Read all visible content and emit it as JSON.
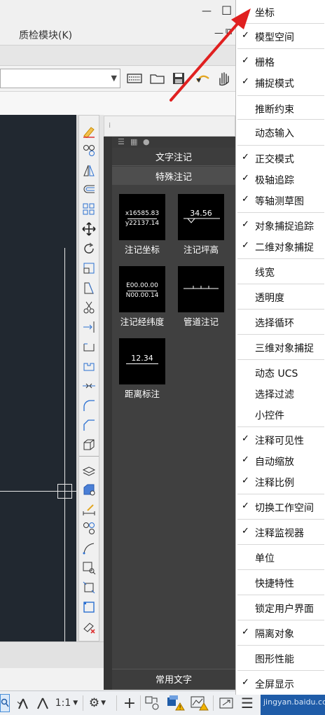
{
  "window": {
    "minimize": "—",
    "maximize": "☐",
    "minimize2": "—",
    "restore2": "⧉"
  },
  "menu_bar": {
    "qc_module": "质检模块(K)"
  },
  "palette": {
    "tab_text": "文字注记",
    "tab_special": "特殊注记",
    "tab_common": "常用文字",
    "tools": [
      {
        "label": "注记坐标",
        "line1": "x16585.83",
        "line2": "y22137.14"
      },
      {
        "label": "注记坪高",
        "line1": "34.56"
      },
      {
        "label": "注记经纬度",
        "line1": "E00.00.00",
        "line2": "N00.00.14"
      },
      {
        "label": "管道注记"
      },
      {
        "label": "距离标注",
        "line1": "12.34"
      }
    ]
  },
  "statusbar": {
    "scale": "1:1"
  },
  "context_menu": {
    "items": [
      {
        "label": "坐标",
        "checked": false
      },
      {
        "label": "模型空间",
        "checked": true
      },
      {
        "label": "栅格",
        "checked": true
      },
      {
        "label": "捕捉模式",
        "checked": true
      },
      {
        "label": "推断约束",
        "checked": false
      },
      {
        "label": "动态输入",
        "checked": false
      },
      {
        "label": "正交模式",
        "checked": true
      },
      {
        "label": "极轴追踪",
        "checked": true
      },
      {
        "label": "等轴测草图",
        "checked": true
      },
      {
        "label": "对象捕捉追踪",
        "checked": true
      },
      {
        "label": "二维对象捕捉",
        "checked": true
      },
      {
        "label": "线宽",
        "checked": false
      },
      {
        "label": "透明度",
        "checked": false
      },
      {
        "label": "选择循环",
        "checked": false
      },
      {
        "label": "三维对象捕捉",
        "checked": false
      },
      {
        "label": "动态 UCS",
        "checked": false
      },
      {
        "label": "选择过滤",
        "checked": false
      },
      {
        "label": "小控件",
        "checked": false
      },
      {
        "label": "注释可见性",
        "checked": true
      },
      {
        "label": "自动缩放",
        "checked": true
      },
      {
        "label": "注释比例",
        "checked": true
      },
      {
        "label": "切换工作空间",
        "checked": true
      },
      {
        "label": "注释监视器",
        "checked": true
      },
      {
        "label": "单位",
        "checked": false
      },
      {
        "label": "快捷特性",
        "checked": false
      },
      {
        "label": "锁定用户界面",
        "checked": false
      },
      {
        "label": "隔离对象",
        "checked": true
      },
      {
        "label": "图形性能",
        "checked": false
      },
      {
        "label": "全屏显示",
        "checked": true
      }
    ],
    "check_glyph": "✓"
  },
  "watermark": {
    "text": "jingyan.baidu.com"
  },
  "colors": {
    "canvas": "#212830",
    "palette": "#404040",
    "annotation_arrow": "#e02020",
    "watermark_bg": "#1f5ca8"
  }
}
